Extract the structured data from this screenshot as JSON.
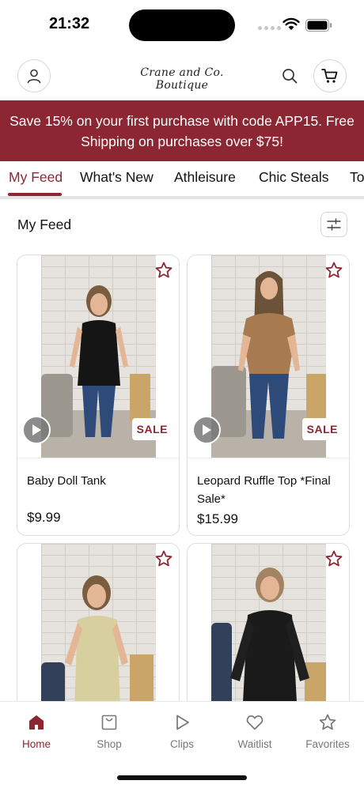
{
  "status_bar": {
    "time": "21:32"
  },
  "header": {
    "brand": "Crane and Co. Boutique",
    "icons": {
      "account": "account-icon",
      "search": "search-icon",
      "cart": "cart-icon"
    }
  },
  "promo": {
    "text": "Save 15% on your first purchase with code APP15. Free Shipping on purchases over $75!"
  },
  "tabs": [
    {
      "label": "My Feed",
      "active": true
    },
    {
      "label": "What's New"
    },
    {
      "label": "Athleisure"
    },
    {
      "label": "Chic Steals"
    },
    {
      "label": "To"
    }
  ],
  "feed": {
    "title": "My Feed",
    "filter_icon": "filter-sliders-icon"
  },
  "products": [
    {
      "name": "Baby Doll Tank",
      "price": "$9.99",
      "badge": "SALE",
      "has_video": true
    },
    {
      "name": "Leopard Ruffle Top *Final Sale*",
      "price": "$15.99",
      "badge": "SALE",
      "has_video": true
    },
    {
      "name": "",
      "price": "",
      "badge": "",
      "has_video": false
    },
    {
      "name": "",
      "price": "",
      "badge": "",
      "has_video": false
    }
  ],
  "bottom_nav": [
    {
      "label": "Home",
      "icon": "home-icon",
      "active": true
    },
    {
      "label": "Shop",
      "icon": "shop-bag-icon"
    },
    {
      "label": "Clips",
      "icon": "play-icon"
    },
    {
      "label": "Waitlist",
      "icon": "heart-icon"
    },
    {
      "label": "Favorites",
      "icon": "star-icon"
    }
  ],
  "colors": {
    "brand": "#8b2632",
    "inactive_nav": "#777777"
  }
}
